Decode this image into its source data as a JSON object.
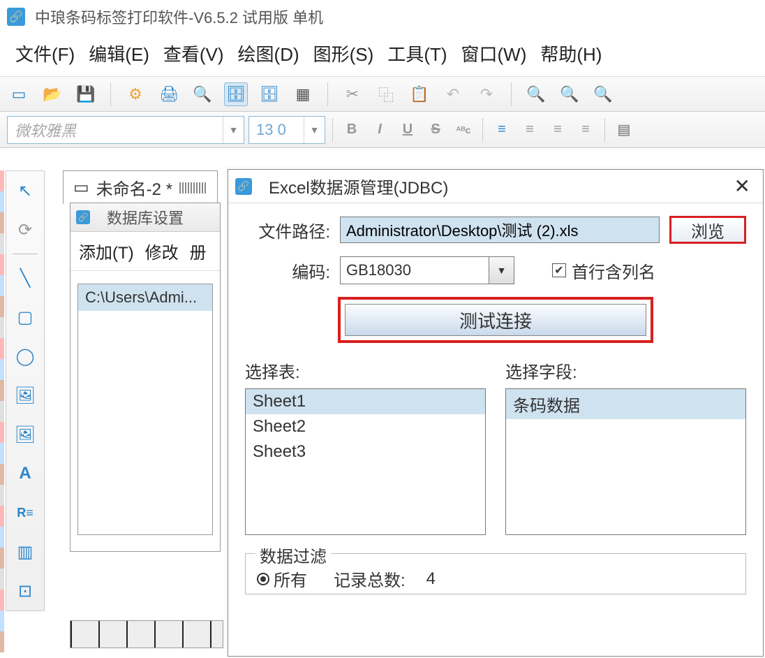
{
  "app": {
    "title": "中琅条码标签打印软件-V6.5.2 试用版 单机"
  },
  "menu": {
    "file": "文件(F)",
    "edit": "编辑(E)",
    "view": "查看(V)",
    "draw": "绘图(D)",
    "shape": "图形(S)",
    "tools": "工具(T)",
    "window": "窗口(W)",
    "help": "帮助(H)"
  },
  "font": {
    "family_placeholder": "微软雅黑",
    "size": "13 0"
  },
  "doc_tab": {
    "title": "未命名-2 *"
  },
  "db_settings": {
    "title": "数据库设置",
    "menu_add": "添加(T)",
    "menu_modify": "修改",
    "menu_delete_prefix": "册",
    "list_item": "C:\\Users\\Admi..."
  },
  "dialog": {
    "title": "Excel数据源管理(JDBC)",
    "close_label": "✕",
    "file_path_label": "文件路径:",
    "file_path_value": "Administrator\\Desktop\\测试 (2).xls",
    "browse": "浏览",
    "encoding_label": "编码:",
    "encoding_value": "GB18030",
    "first_row_checkbox": "首行含列名",
    "first_row_checked": true,
    "test_connection": "测试连接",
    "select_table_label": "选择表:",
    "tables": [
      "Sheet1",
      "Sheet2",
      "Sheet3"
    ],
    "table_selected_index": 0,
    "select_field_label": "选择字段:",
    "fields": [
      "条码数据"
    ],
    "field_selected_index": 0,
    "filter_legend": "数据过滤",
    "filter_all": "所有",
    "filter_all_selected": true,
    "record_count_label": "记录总数:",
    "record_count_value": "4"
  }
}
